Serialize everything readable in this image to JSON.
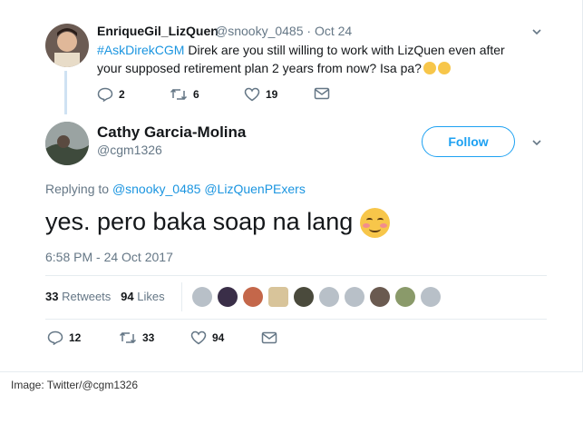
{
  "reply_tweet": {
    "display_name": "EnriqueGil_LizQuen",
    "handle_date": "@snooky_0485 · Oct 24",
    "hashtag": "#AskDirekCGM",
    "text": "Direk are you still willing to work with LizQuen even after your supposed retirement plan 2 years from now? Isa pa?",
    "replies": "2",
    "retweets": "6",
    "likes": "19"
  },
  "main_tweet": {
    "display_name": "Cathy Garcia-Molina",
    "handle": "@cgm1326",
    "follow_label": "Follow",
    "replying_to_label": "Replying to",
    "mention1": "@snooky_0485",
    "mention2": "@LizQuenPExers",
    "text": "yes. pero baka soap na lang",
    "timestamp": "6:58 PM - 24 Oct 2017",
    "retweets_count": "33",
    "retweets_label": "Retweets",
    "likes_count": "94",
    "likes_label": "Likes",
    "replies": "12",
    "retweets": "33",
    "likes": "94"
  },
  "caption": "Image: Twitter/@cgm1326",
  "colors": {
    "link": "#1b95e0",
    "muted": "#657786",
    "follow": "#1da1f2"
  },
  "icons": [
    "reply-icon",
    "retweet-icon",
    "like-icon",
    "direct-message-icon",
    "chevron-down-icon"
  ]
}
